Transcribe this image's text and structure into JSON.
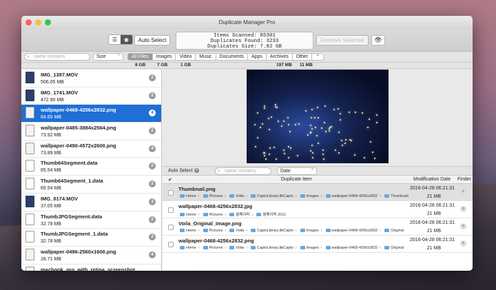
{
  "window": {
    "title": "Duplicate Manager Pro"
  },
  "toolbar": {
    "auto_select": "Auto Select",
    "stats": [
      "Items Scanned: 85301",
      "Duplicates Found: 3233",
      "Duplicates Size: 7.82 GB"
    ],
    "remove_selected": "Remove Selected"
  },
  "filters": {
    "name_placeholder": "name contains",
    "sort": "Size",
    "tabs": [
      "All Files",
      "Images",
      "Video",
      "Music",
      "Documents",
      "Apps",
      "Archives",
      "Other"
    ],
    "active_tab": "All Files",
    "sizes": [
      {
        "tab": "All Files",
        "size": "8 GB"
      },
      {
        "tab": "Images",
        "size": "7 GB"
      },
      {
        "tab": "Video",
        "size": "1 GB"
      },
      {
        "tab": "Archives",
        "size": "197 MB"
      },
      {
        "tab": "Other",
        "size": "11 MB"
      }
    ]
  },
  "files": [
    {
      "name": "IMG_1397.MOV",
      "size": "506.05 MB",
      "count": "2",
      "type": "mov"
    },
    {
      "name": "IMG_1741.MOV",
      "size": "472.90 MB",
      "count": "2",
      "type": "mov"
    },
    {
      "name": "wallpaper-0468-4256x2832.png",
      "size": "84.65 MB",
      "count": "4",
      "type": "png",
      "selected": true
    },
    {
      "name": "wallpaper-0485-3884x2564.png",
      "size": "73.92 MB",
      "count": "2",
      "type": "png"
    },
    {
      "name": "wallpaper-0490-4572x2600.png",
      "size": "73.89 MB",
      "count": "4",
      "type": "png"
    },
    {
      "name": "Thumb64Segment.data",
      "size": "65.54 MB",
      "count": "2",
      "type": "doc"
    },
    {
      "name": "Thumb64Segment_1.data",
      "size": "65.54 MB",
      "count": "2",
      "type": "doc"
    },
    {
      "name": "IMG_0174.MOV",
      "size": "37.05 MB",
      "count": "3",
      "type": "mov"
    },
    {
      "name": "ThumbJPGSegment.data",
      "size": "32.78 MB",
      "count": "2",
      "type": "doc"
    },
    {
      "name": "ThumbJPGSegment_1.data",
      "size": "32.78 MB",
      "count": "2",
      "type": "doc"
    },
    {
      "name": "wallpaper-0496-2560x1600.png",
      "size": "28.71 MB",
      "count": "4",
      "type": "png"
    },
    {
      "name": "macbook_pro_with_retina_screenshot...",
      "size": "",
      "count": "",
      "type": "png"
    }
  ],
  "duplicates": {
    "auto_select": "Auto Select",
    "name_placeholder": "name contains",
    "sort": "Date",
    "headers": {
      "check": "✔",
      "item": "Duplicate Item",
      "date": "Modification Date",
      "finder": "Finder"
    },
    "rows": [
      {
        "name": "Thumbnail.png",
        "path": [
          "Home",
          "Pictures",
          "Voila",
          "CaptoLibrary.libCapto",
          "Images",
          "wallpaper-0468-4256x2832",
          "Thumbnail"
        ],
        "date": "2016-04-28 06:21:31",
        "size": "21 MB",
        "highlight": true
      },
      {
        "name": "wallpaper-0468-4256x2832.jpg",
        "path": [
          "Home",
          "Pictures",
          "월페이퍼",
          "월페이퍼 2011"
        ],
        "date": "2016-04-28 06:21:31",
        "size": "21 MB"
      },
      {
        "name": "Voila_Original_Image.png",
        "path": [
          "Home",
          "Pictures",
          "Voila",
          "CaptoLibrary.libCapto",
          "Images",
          "wallpaper-0468-4256x2832",
          "Original"
        ],
        "date": "2016-04-28 06:21:31",
        "size": "21 MB"
      },
      {
        "name": "wallpaper-0468-4256x2832.png",
        "path": [
          "Home",
          "Pictures",
          "Voila",
          "CaptoLibrary.libCapto",
          "Images",
          "wallpaper-0468-4256x2832",
          "Original"
        ],
        "date": "2016-04-28 06:21:31",
        "size": "21 MB"
      }
    ]
  },
  "colors": {
    "selection": "#1f6fd6",
    "folder": "#5ea9e6"
  }
}
